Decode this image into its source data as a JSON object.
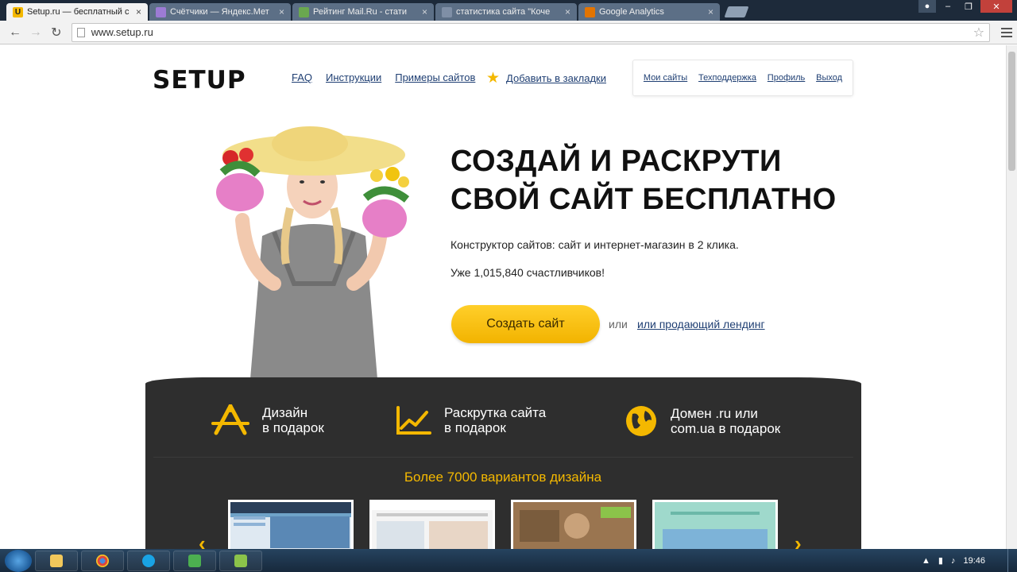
{
  "browser": {
    "tabs": [
      {
        "title": "Setup.ru — бесплатный с",
        "active": true,
        "favicon": "U"
      },
      {
        "title": "Счётчики — Яндекс.Мет",
        "active": false,
        "favicon": ""
      },
      {
        "title": "Рейтинг Mail.Ru - стати",
        "active": false,
        "favicon": ""
      },
      {
        "title": "статистика сайта \"Коче",
        "active": false,
        "favicon": ""
      },
      {
        "title": "Google Analytics",
        "active": false,
        "favicon": ""
      }
    ],
    "url": "www.setup.ru"
  },
  "header": {
    "logo": "SETUP",
    "nav": [
      "FAQ",
      "Инструкции",
      "Примеры сайтов"
    ],
    "bookmark": "Добавить в закладки",
    "user_links": [
      "Мои сайты",
      "Техподдержка",
      "Профиль",
      "Выход"
    ]
  },
  "hero": {
    "headline_line1": "СОЗДАЙ И РАСКРУТИ",
    "headline_line2": "СВОЙ САЙТ БЕСПЛАТНО",
    "subtitle": "Конструктор сайтов: сайт и интернет-магазин в 2 клика.",
    "counter": "Уже 1,015,840 счастливчиков!",
    "cta": "Создать сайт",
    "or": "или",
    "landing_link": "или продающий лендинг"
  },
  "features": [
    {
      "line1": "Дизайн",
      "line2": "в подарок",
      "icon": "design-icon"
    },
    {
      "line1": "Раскрутка сайта",
      "line2": "в подарок",
      "icon": "chart-icon"
    },
    {
      "line1": "Домен .ru или",
      "line2": "com.ua в подарок",
      "icon": "globe-icon"
    }
  ],
  "designs_title": "Более 7000 вариантов дизайна",
  "taskbar": {
    "clock": "19:46"
  },
  "colors": {
    "accent": "#f4b800",
    "dark": "#2e2e2e",
    "link": "#1f3f73"
  }
}
